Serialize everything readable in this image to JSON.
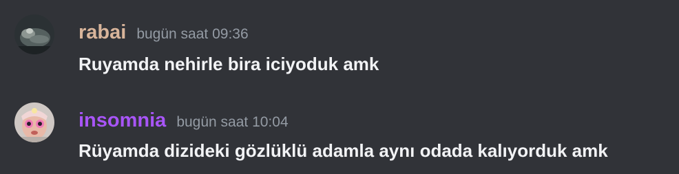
{
  "messages": [
    {
      "username": "rabai",
      "username_color": "#d9b59b",
      "timestamp": "bugün saat 09:36",
      "content": "Ruyamda nehirle bira iciyoduk amk",
      "avatar_icon": "user-avatar-photo"
    },
    {
      "username": "insomnia",
      "username_color": "#a855f7",
      "timestamp": "bugün saat 10:04",
      "content": "Rüyamda dizideki gözlüklü adamla aynı odada kalıyorduk amk",
      "avatar_icon": "user-avatar-photo"
    }
  ],
  "colors": {
    "background": "#313338",
    "timestamp": "#949ba4",
    "message_text": "#f2f3f5"
  }
}
